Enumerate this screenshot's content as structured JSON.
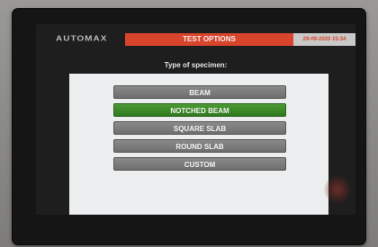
{
  "header": {
    "logo_text": "AUTOMAX",
    "title": "TEST OPTIONS",
    "datetime": "29-09-2020 15:34"
  },
  "prompt": "Type of specimen:",
  "options": [
    {
      "label": "BEAM",
      "selected": false
    },
    {
      "label": "NOTCHED BEAM",
      "selected": true
    },
    {
      "label": "SQUARE SLAB",
      "selected": false
    },
    {
      "label": "ROUND SLAB",
      "selected": false
    },
    {
      "label": "CUSTOM",
      "selected": false
    }
  ],
  "colors": {
    "title_bar": "#d9452c",
    "selected_option": "#3f8a2a",
    "option": "#7a7a7a",
    "panel": "#eceeef"
  }
}
